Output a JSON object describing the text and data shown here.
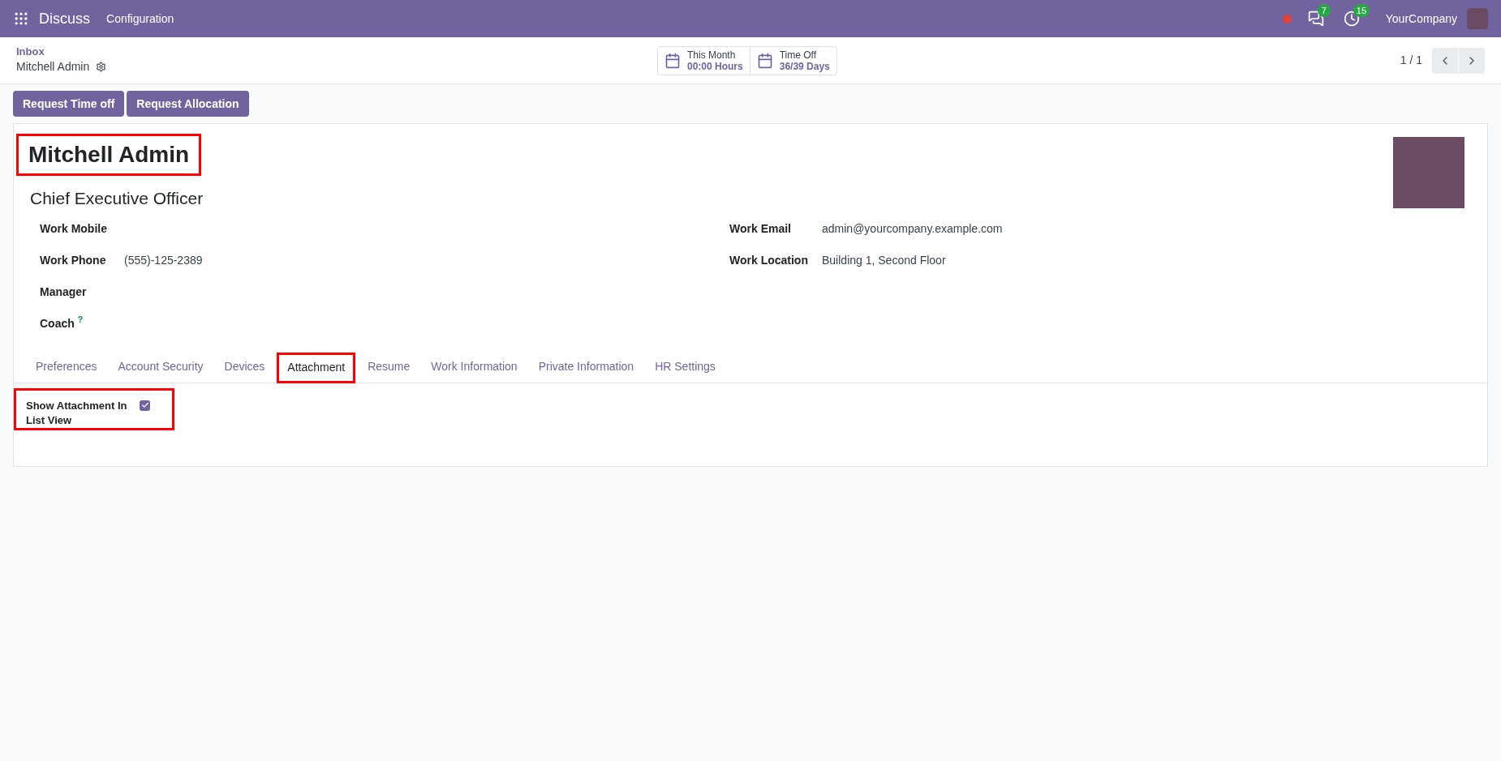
{
  "navbar": {
    "app_name": "Discuss",
    "menu": [
      "Configuration"
    ],
    "chat_badge": "7",
    "activity_badge": "15",
    "company": "YourCompany"
  },
  "breadcrumb": {
    "parent": "Inbox",
    "current": "Mitchell Admin"
  },
  "stat_buttons": [
    {
      "label": "This Month",
      "value": "00:00 Hours"
    },
    {
      "label": "Time Off",
      "value": "36/39 Days"
    }
  ],
  "pager": "1 / 1",
  "action_buttons": [
    "Request Time off",
    "Request Allocation"
  ],
  "form": {
    "name": "Mitchell Admin",
    "name_highlighted": true,
    "job_title": "Chief Executive Officer",
    "left_fields": [
      {
        "label": "Work Mobile"
      },
      {
        "label": "Work Phone",
        "value": "(555)-125-2389"
      },
      {
        "label": "Manager"
      },
      {
        "label": "Coach",
        "help_mark": "?"
      }
    ],
    "right_fields": [
      {
        "label": "Work Email",
        "value": "admin@yourcompany.example.com"
      },
      {
        "label": "Work Location",
        "value": "Building 1, Second Floor"
      }
    ],
    "tabs": [
      {
        "label": "Preferences",
        "selected": false,
        "highlighted": false
      },
      {
        "label": "Account Security",
        "selected": false,
        "highlighted": false
      },
      {
        "label": "Devices",
        "selected": false,
        "highlighted": false
      },
      {
        "label": "Attachment",
        "selected": true,
        "highlighted": true
      },
      {
        "label": "Resume",
        "selected": false,
        "highlighted": false
      },
      {
        "label": "Work Information",
        "selected": false,
        "highlighted": false
      },
      {
        "label": "Private Information",
        "selected": false,
        "highlighted": false
      },
      {
        "label": "HR Settings",
        "selected": false,
        "highlighted": false
      }
    ],
    "setting": {
      "label": "Show Attachment In List View",
      "checked": true,
      "highlighted": true
    }
  }
}
